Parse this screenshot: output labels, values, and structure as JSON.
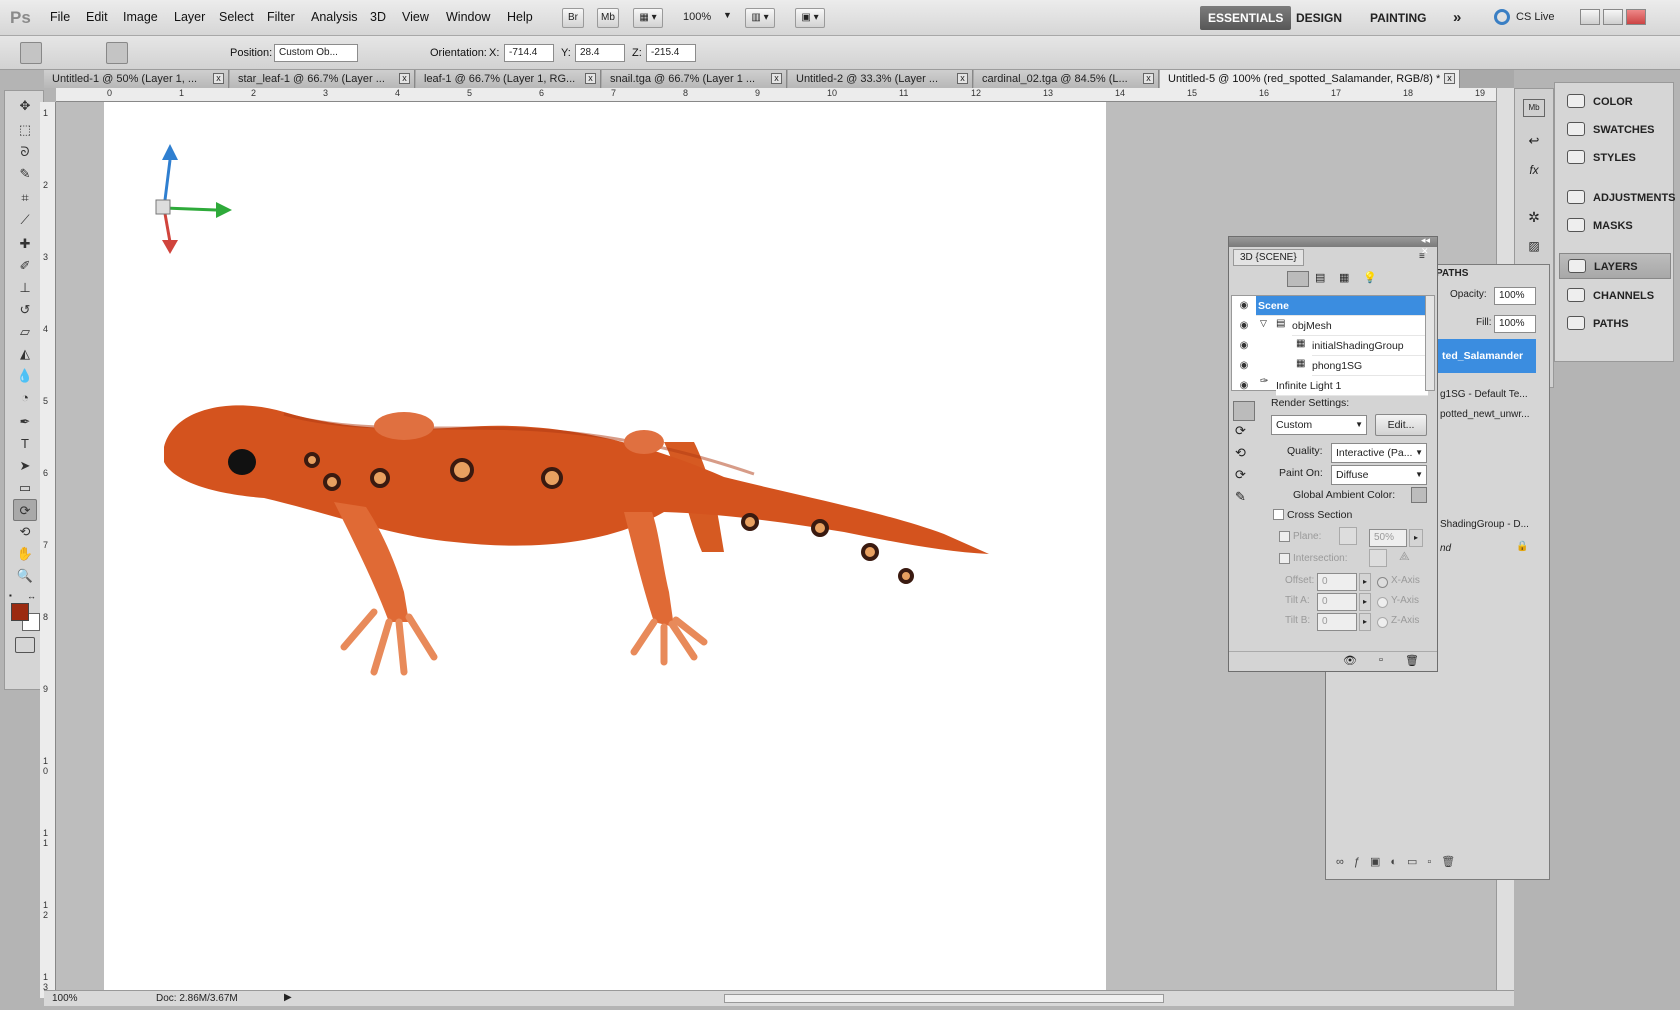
{
  "app": {
    "logo": "Ps"
  },
  "menu": [
    "File",
    "Edit",
    "Image",
    "Layer",
    "Select",
    "Filter",
    "Analysis",
    "3D",
    "View",
    "Window",
    "Help"
  ],
  "appbar": {
    "br": "Br",
    "mb": "Mb",
    "zoom": "100%"
  },
  "workspaces": {
    "essentials": "ESSENTIALS",
    "design": "DESIGN",
    "painting": "PAINTING",
    "more": "»",
    "cslive": "CS Live"
  },
  "options": {
    "position_label": "Position:",
    "position_value": "Custom Ob...",
    "orientation_label": "Orientation:",
    "x_label": "X:",
    "x_value": "-714.4",
    "y_label": "Y:",
    "y_value": "28.4",
    "z_label": "Z:",
    "z_value": "-215.4"
  },
  "tabs": [
    {
      "label": "Untitled-1 @ 50% (Layer 1, ..."
    },
    {
      "label": "star_leaf-1 @ 66.7% (Layer ..."
    },
    {
      "label": "leaf-1 @ 66.7% (Layer 1, RG..."
    },
    {
      "label": "snail.tga @ 66.7% (Layer 1 ..."
    },
    {
      "label": "Untitled-2 @ 33.3% (Layer ..."
    },
    {
      "label": "cardinal_02.tga @ 84.5% (L..."
    },
    {
      "label": "Untitled-5 @ 100% (red_spotted_Salamander, RGB/8) *"
    }
  ],
  "ruler_h": [
    "0",
    "1",
    "2",
    "3",
    "4",
    "5",
    "6",
    "7",
    "8",
    "9",
    "10",
    "11",
    "12",
    "13",
    "14",
    "15",
    "16",
    "17",
    "18",
    "19"
  ],
  "ruler_v": [
    "1",
    "2",
    "3",
    "4",
    "5",
    "6",
    "7",
    "8",
    "9",
    "1 0",
    "1 1",
    "1 2",
    "1 3"
  ],
  "status": {
    "zoom": "100%",
    "doc": "Doc: 2.86M/3.67M"
  },
  "colors": {
    "foreground": "#9b2a10",
    "background": "#ffffff",
    "salamander": "#d4531e"
  },
  "dock": {
    "items": [
      "COLOR",
      "SWATCHES",
      "STYLES",
      "ADJUSTMENTS",
      "MASKS",
      "LAYERS",
      "CHANNELS",
      "PATHS"
    ]
  },
  "layers_panel": {
    "tab": "PATHS",
    "opacity_label": "Opacity:",
    "opacity_value": "100%",
    "fill_label": "Fill:",
    "fill_value": "100%",
    "layer_name": "ted_Salamander",
    "row1": "g1SG - Default Te...",
    "row2": "potted_newt_unwr...",
    "row3": "ShadingGroup - D...",
    "row4": "nd"
  },
  "scene": {
    "title": "3D {SCENE}",
    "tree": [
      {
        "label": "Scene"
      },
      {
        "label": "objMesh"
      },
      {
        "label": "initialShadingGroup"
      },
      {
        "label": "phong1SG"
      },
      {
        "label": "Infinite Light 1"
      }
    ],
    "render_settings_label": "Render Settings:",
    "render_value": "Custom",
    "edit_button": "Edit...",
    "quality_label": "Quality:",
    "quality_value": "Interactive (Pa...",
    "paint_on_label": "Paint On:",
    "paint_on_value": "Diffuse",
    "ambient_label": "Global Ambient Color:",
    "cross_section_label": "Cross Section",
    "plane_label": "Plane:",
    "plane_value": "50%",
    "intersection_label": "Intersection:",
    "offset_label": "Offset:",
    "offset_value": "0",
    "tilt_a_label": "Tilt A:",
    "tilt_a_value": "0",
    "tilt_b_label": "Tilt B:",
    "tilt_b_value": "0",
    "x_axis": "X-Axis",
    "y_axis": "Y-Axis",
    "z_axis": "Z-Axis"
  }
}
